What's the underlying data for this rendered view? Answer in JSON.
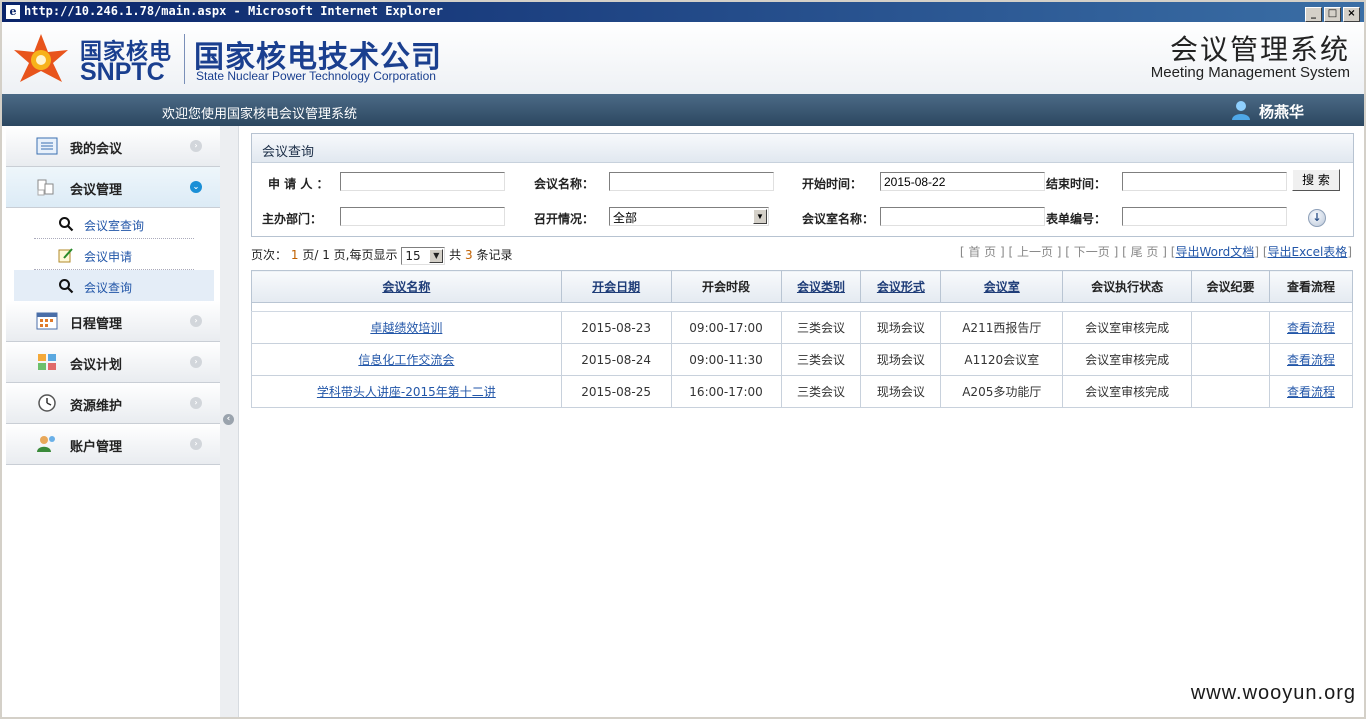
{
  "window": {
    "title": "http://10.246.1.78/main.aspx - Microsoft Internet Explorer",
    "btn_min": "_",
    "btn_max": "□",
    "btn_close": "×"
  },
  "header": {
    "logo_cn": "国家核电",
    "logo_en": "SNPTC",
    "company_cn": "国家核电技术公司",
    "company_en": "State Nuclear Power Technology Corporation",
    "system_cn": "会议管理系统",
    "system_en": "Meeting Management System"
  },
  "navbar": {
    "welcome": "欢迎您使用国家核电会议管理系统",
    "user": "杨燕华"
  },
  "sidebar": {
    "my_meetings": "我的会议",
    "meeting_mgmt": "会议管理",
    "sub": [
      "会议室查询",
      "会议申请",
      "会议查询"
    ],
    "schedule": "日程管理",
    "plan": "会议计划",
    "resource": "资源维护",
    "account": "账户管理"
  },
  "query": {
    "title": "会议查询",
    "applicant_label": "申 请 人 ：",
    "applicant_value": "",
    "name_label": "会议名称：",
    "name_value": "",
    "start_label": "开始时间：",
    "start_value": "2015-08-22",
    "end_label": "结束时间：",
    "end_value": "",
    "search_button": "搜 索",
    "dept_label": "主办部门：",
    "dept_value": "",
    "status_label": "召开情况：",
    "status_value": "全部",
    "room_label": "会议室名称：",
    "room_value": "",
    "form_label": "表单编号：",
    "form_value": "",
    "expand_icon": "↓"
  },
  "pager": {
    "page_label": "页次：",
    "current_page": "1",
    "page_sep": "页/",
    "total_pages": "1",
    "per_page_label": "页,每页显示",
    "per_page": "15",
    "total_label": "共",
    "total_records": "3",
    "records_label": "条记录",
    "first": "[ 首 页 ]",
    "prev": "[ 上一页 ]",
    "next": "[ 下一页 ]",
    "last": "[ 尾 页 ]",
    "bracket_open": "[",
    "bracket_close": "]",
    "export_word": "导出Word文档",
    "export_excel": "导出Excel表格"
  },
  "table": {
    "headers": [
      "会议名称",
      "开会日期",
      "开会时段",
      "会议类别",
      "会议形式",
      "会议室",
      "会议执行状态",
      "会议纪要",
      "查看流程"
    ],
    "rows": [
      [
        "卓越绩效培训",
        "2015-08-23",
        "09:00-17:00",
        "三类会议",
        "现场会议",
        "A211西报告厅",
        "会议室审核完成",
        "",
        "查看流程"
      ],
      [
        "信息化工作交流会",
        "2015-08-24",
        "09:00-11:30",
        "三类会议",
        "现场会议",
        "A1120会议室",
        "会议室审核完成",
        "",
        "查看流程"
      ],
      [
        "学科带头人讲座-2015年第十二讲",
        "2015-08-25",
        "16:00-17:00",
        "三类会议",
        "现场会议",
        "A205多功能厅",
        "会议室审核完成",
        "",
        "查看流程"
      ]
    ]
  },
  "watermark": "www.wooyun.org",
  "colors": {
    "brand_blue": "#1a3f8f",
    "nav_dark": "#2c4760",
    "link": "#2256a8",
    "accent": "#1b8fd6"
  }
}
